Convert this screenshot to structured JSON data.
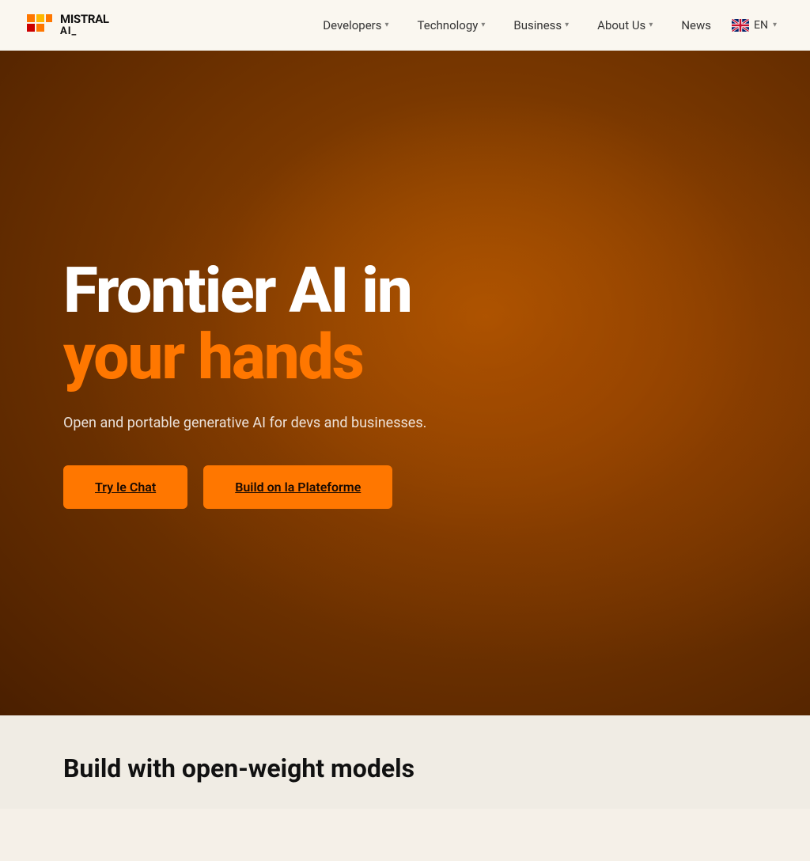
{
  "nav": {
    "logo_name": "MISTRAL",
    "logo_sub": "AI_",
    "links": [
      {
        "label": "Developers",
        "has_dropdown": true
      },
      {
        "label": "Technology",
        "has_dropdown": true
      },
      {
        "label": "Business",
        "has_dropdown": true
      },
      {
        "label": "About Us",
        "has_dropdown": true
      },
      {
        "label": "News",
        "has_dropdown": false
      }
    ],
    "lang_label": "EN"
  },
  "hero": {
    "headline_white": "Frontier AI in",
    "headline_accent": "your hands",
    "subtitle": "Open and portable generative AI for devs and businesses.",
    "btn_primary": "Try le Chat",
    "btn_secondary": "Build on la Plateforme"
  },
  "bottom": {
    "heading": "Build with open-weight models"
  },
  "colors": {
    "accent": "#ff7700",
    "hero_bg_start": "#b85c00",
    "hero_bg_end": "#4a1f00"
  }
}
